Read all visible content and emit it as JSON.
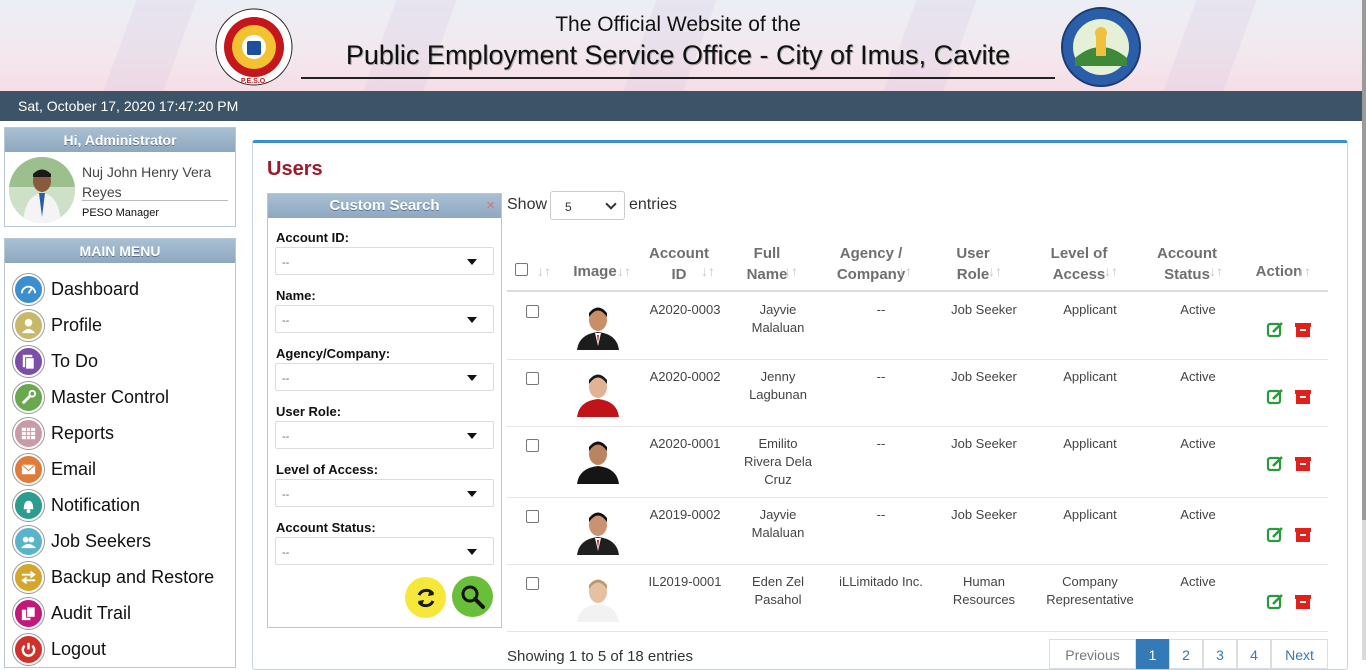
{
  "header": {
    "line1": "The Official Website of the",
    "line2": "Public Employment Service Office - City of Imus, Cavite",
    "logo_left_text": "PUBLIC EMPLOYMENT SERVICE OFFICE P.E.S.O.",
    "logo_right_text": "LUNGSOD NG IMUS LALAWIGAN NG CAVITE 2012"
  },
  "datetime": "Sat, October 17, 2020 17:47:20 PM",
  "user": {
    "greeting": "Hi, Administrator",
    "name": "Nuj John Henry Vera Reyes",
    "role": "PESO Manager"
  },
  "menu": {
    "title": "MAIN MENU",
    "items": [
      {
        "label": "Dashboard",
        "icon": "dashboard-icon",
        "color": "#3b8fd0"
      },
      {
        "label": "Profile",
        "icon": "profile-icon",
        "color": "#c9b86a"
      },
      {
        "label": "To Do",
        "icon": "todo-icon",
        "color": "#7b4fa8"
      },
      {
        "label": "Master Control",
        "icon": "wrench-icon",
        "color": "#6aa84f"
      },
      {
        "label": "Reports",
        "icon": "reports-icon",
        "color": "#c99aa8"
      },
      {
        "label": "Email",
        "icon": "email-icon",
        "color": "#e07b39"
      },
      {
        "label": "Notification",
        "icon": "bell-icon",
        "color": "#2a9d8f"
      },
      {
        "label": "Job Seekers",
        "icon": "job-seekers-icon",
        "color": "#5ab4c9"
      },
      {
        "label": "Backup and Restore",
        "icon": "backup-icon",
        "color": "#d4a72c"
      },
      {
        "label": "Audit Trail",
        "icon": "audit-icon",
        "color": "#c2187a"
      },
      {
        "label": "Logout",
        "icon": "power-icon",
        "color": "#d0312d"
      }
    ]
  },
  "page": {
    "title": "Users"
  },
  "custom_search": {
    "title": "Custom Search",
    "close": "×",
    "fields": [
      {
        "label": "Account ID:",
        "value": "--"
      },
      {
        "label": "Name:",
        "value": "--"
      },
      {
        "label": "Agency/Company:",
        "value": "--"
      },
      {
        "label": "User Role:",
        "value": "--"
      },
      {
        "label": "Level of Access:",
        "value": "--"
      },
      {
        "label": "Account Status:",
        "value": "--"
      }
    ]
  },
  "table_controls": {
    "show": "Show",
    "entries_value": "5",
    "entries": "entries"
  },
  "table": {
    "headers": [
      {
        "l1": "",
        "l2": "Image"
      },
      {
        "l1": "Account",
        "l2": "ID"
      },
      {
        "l1": "Full",
        "l2": "Name"
      },
      {
        "l1": "Agency /",
        "l2": "Company"
      },
      {
        "l1": "User",
        "l2": "Role"
      },
      {
        "l1": "Level of",
        "l2": "Access"
      },
      {
        "l1": "Account",
        "l2": "Status"
      },
      {
        "l1": "",
        "l2": "Action"
      }
    ],
    "rows": [
      {
        "id": "A2020-0003",
        "name1": "Jayvie",
        "name2": "Malaluan",
        "name3": "",
        "agency": "--",
        "role1": "Job Seeker",
        "role2": "",
        "access1": "Applicant",
        "access2": "",
        "status": "Active"
      },
      {
        "id": "A2020-0002",
        "name1": "Jenny",
        "name2": "Lagbunan",
        "name3": "",
        "agency": "--",
        "role1": "Job Seeker",
        "role2": "",
        "access1": "Applicant",
        "access2": "",
        "status": "Active"
      },
      {
        "id": "A2020-0001",
        "name1": "Emilito",
        "name2": "Rivera Dela",
        "name3": "Cruz",
        "agency": "--",
        "role1": "Job Seeker",
        "role2": "",
        "access1": "Applicant",
        "access2": "",
        "status": "Active"
      },
      {
        "id": "A2019-0002",
        "name1": "Jayvie",
        "name2": "Malaluan",
        "name3": "",
        "agency": "--",
        "role1": "Job Seeker",
        "role2": "",
        "access1": "Applicant",
        "access2": "",
        "status": "Active"
      },
      {
        "id": "IL2019-0001",
        "name1": "Eden Zel",
        "name2": "Pasahol",
        "name3": "",
        "agency": "iLLimitado Inc.",
        "role1": "Human",
        "role2": "Resources",
        "access1": "Company",
        "access2": "Representative",
        "status": "Active"
      }
    ]
  },
  "footer": {
    "info": "Showing 1 to 5 of 18 entries",
    "pages": [
      "Previous",
      "1",
      "2",
      "3",
      "4",
      "Next"
    ]
  }
}
